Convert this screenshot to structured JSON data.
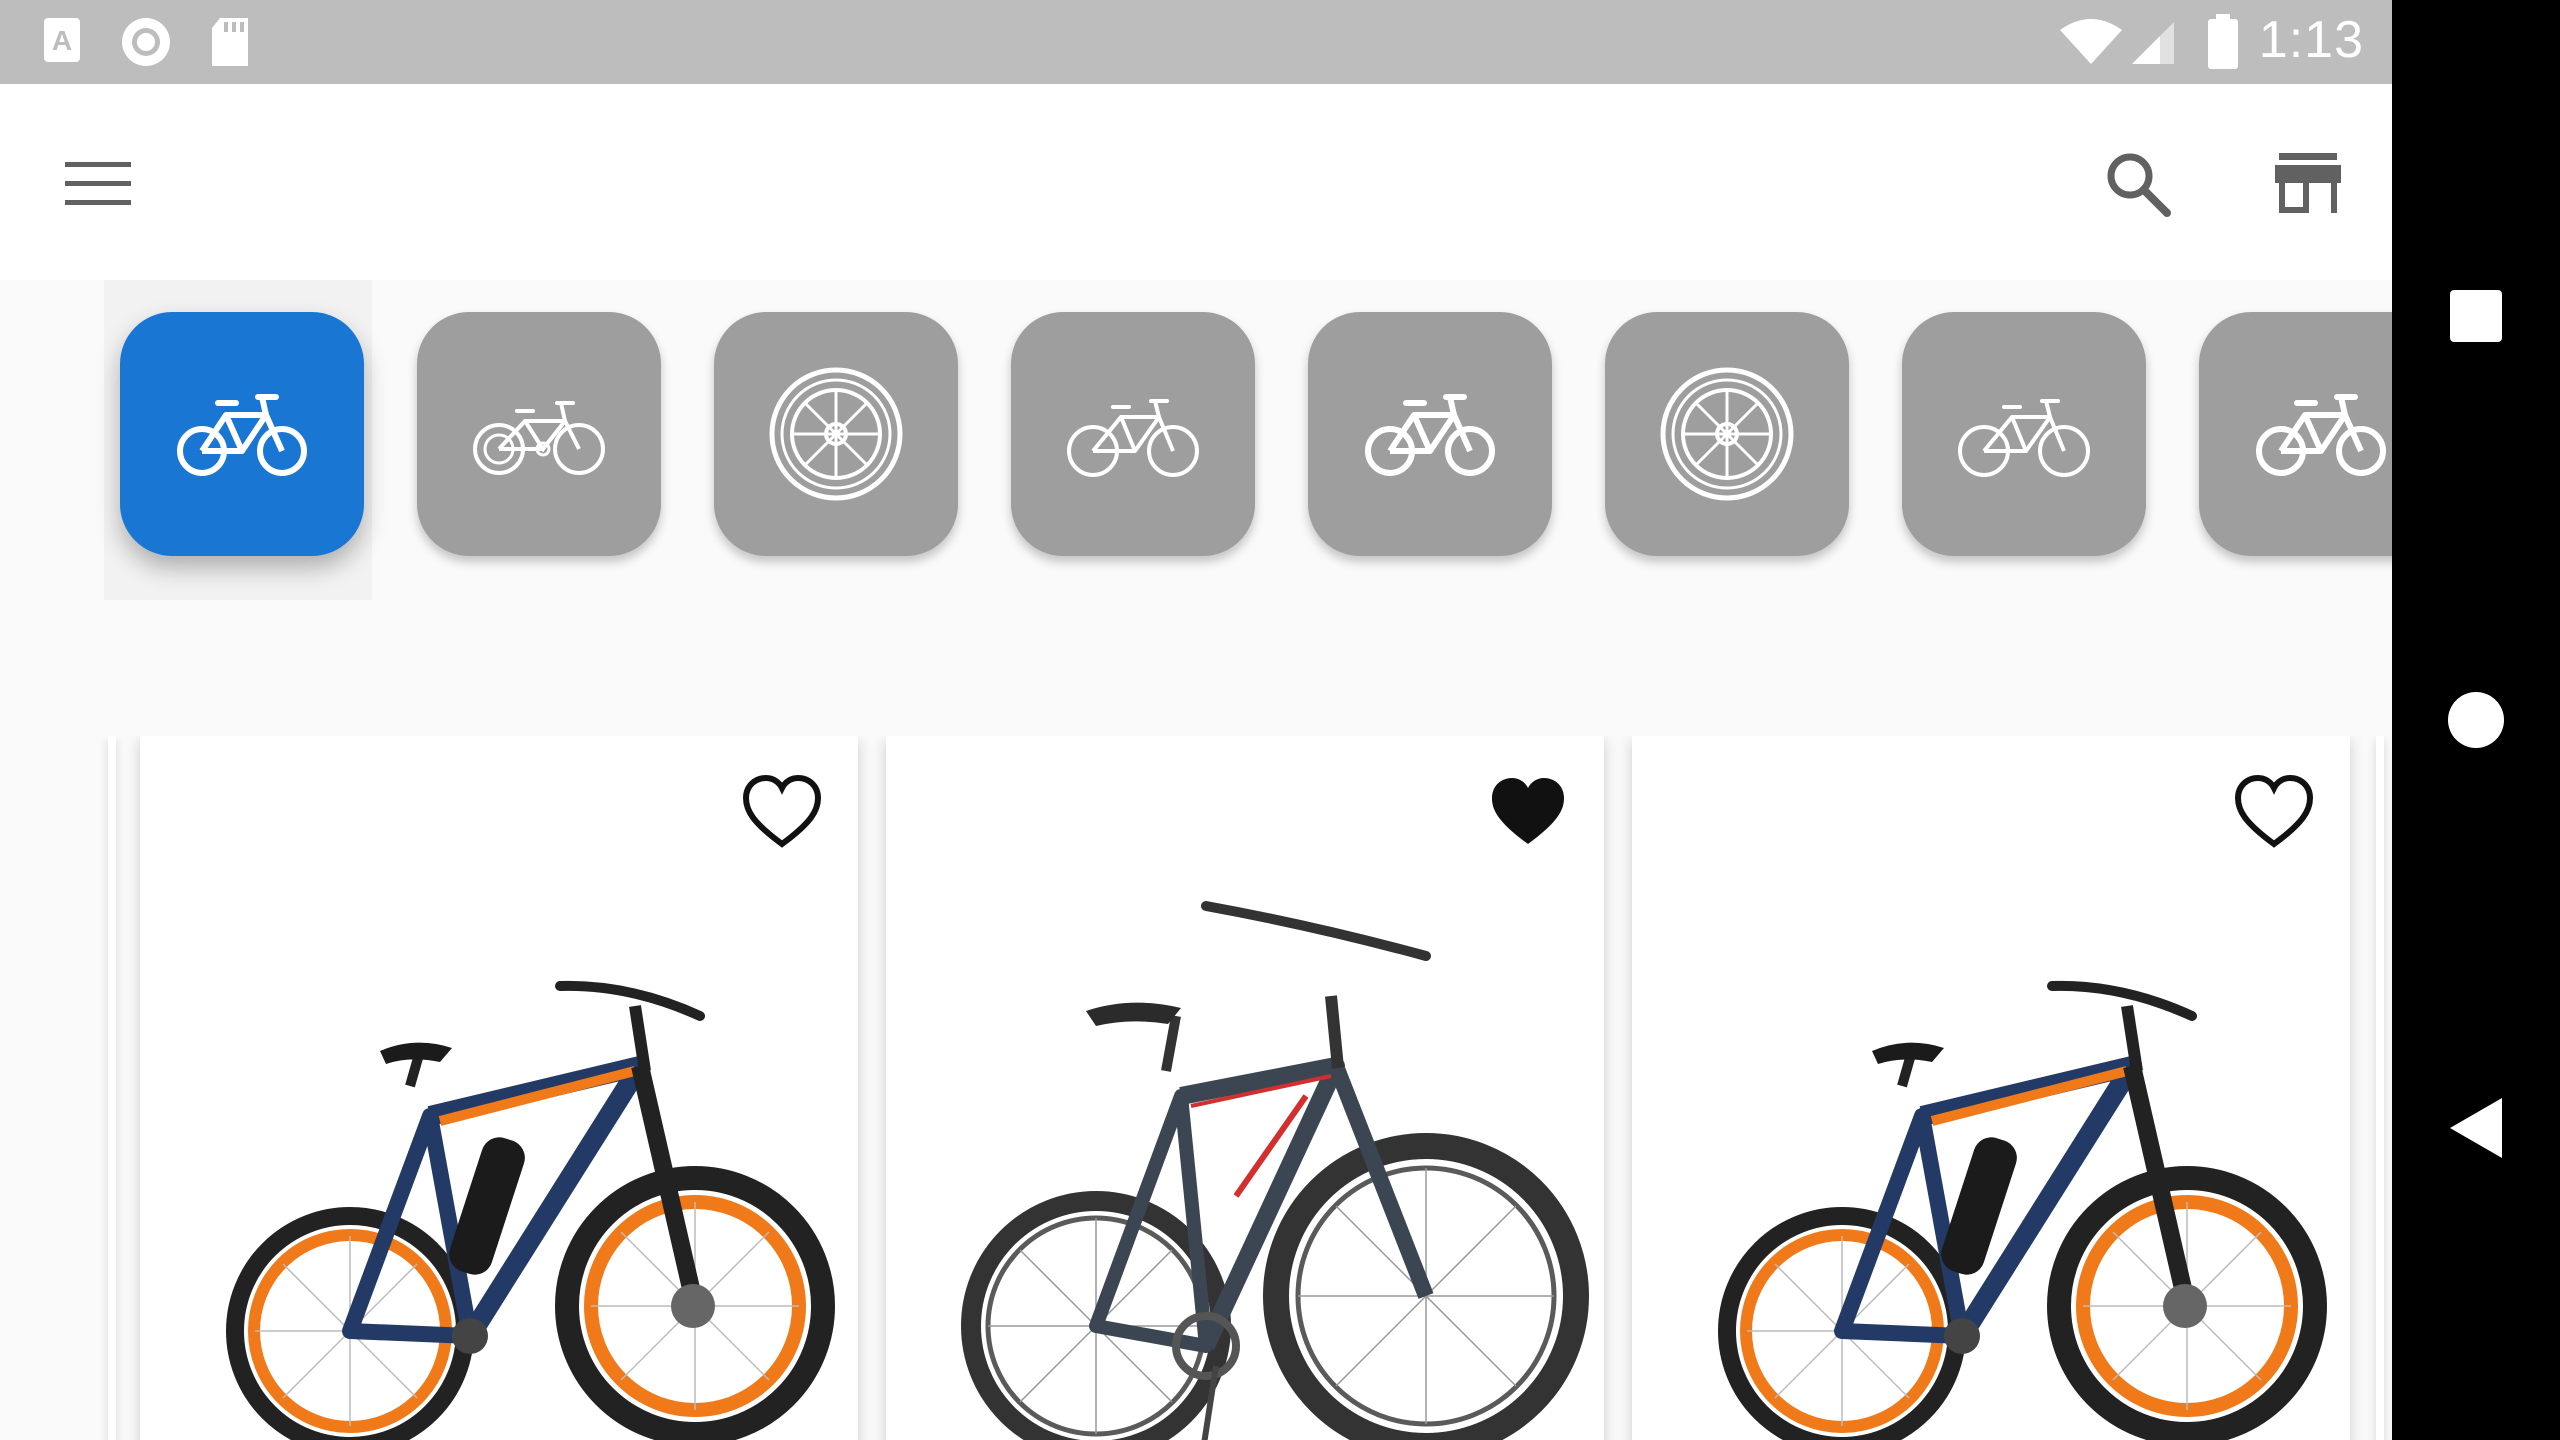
{
  "status_bar": {
    "time": "1:13",
    "left_icons": [
      "a-notification-icon",
      "record-icon",
      "sd-card-icon"
    ],
    "right_icons": [
      "wifi-icon",
      "signal-icon",
      "battery-icon"
    ]
  },
  "app_bar": {
    "menu_icon": "menu-icon",
    "search_icon": "search-icon",
    "store_icon": "store-icon"
  },
  "categories": [
    {
      "icon": "bicycle-icon",
      "active": true
    },
    {
      "icon": "kids-bicycle-icon",
      "active": false
    },
    {
      "icon": "wheel-icon",
      "active": false
    },
    {
      "icon": "road-bike-icon",
      "active": false
    },
    {
      "icon": "bicycle-icon",
      "active": false
    },
    {
      "icon": "wheel-icon",
      "active": false
    },
    {
      "icon": "road-bike-icon",
      "active": false
    },
    {
      "icon": "bicycle-icon",
      "active": false
    }
  ],
  "products": [
    {
      "image": "orange-electric-mountain-bike",
      "favorite": false
    },
    {
      "image": "dark-grey-mountain-bike",
      "favorite": true
    },
    {
      "image": "orange-electric-mountain-bike",
      "favorite": false
    }
  ],
  "colors": {
    "accent": "#1976d2",
    "category_inactive": "#9e9e9e",
    "status_bar": "#bdbdbd",
    "orange": "#f07a1a",
    "navy": "#243a66"
  }
}
